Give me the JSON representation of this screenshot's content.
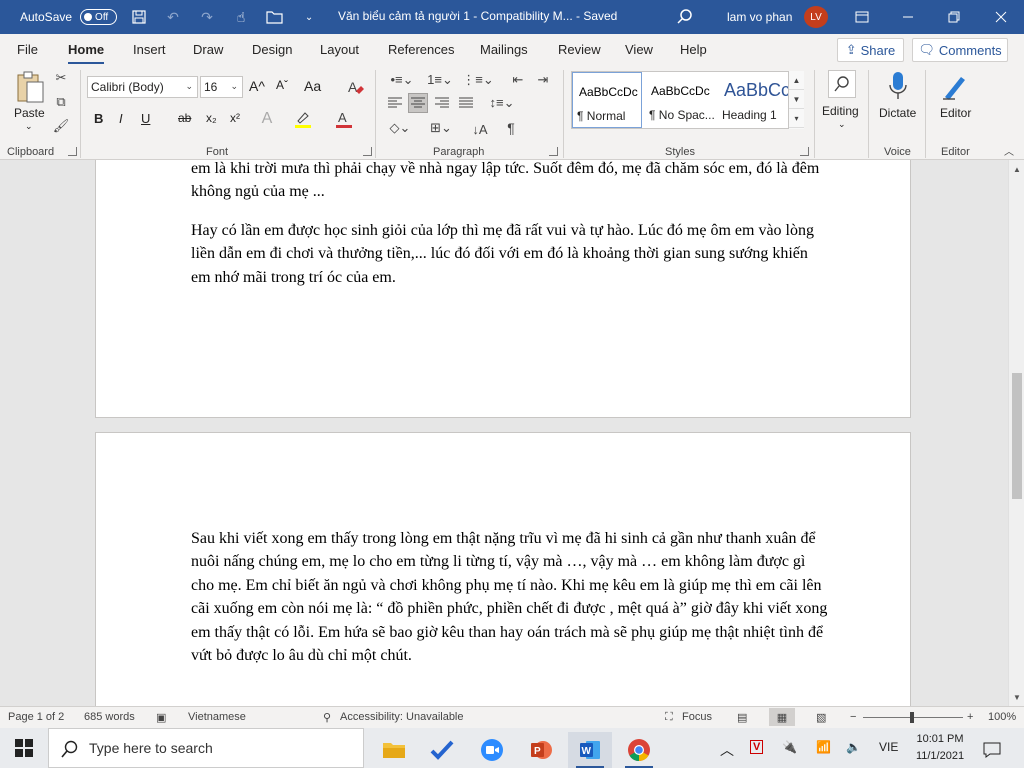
{
  "titlebar": {
    "autosave_label": "AutoSave",
    "autosave_state": "Off",
    "doc_title": "Văn biểu cảm tả người 1  -  Compatibility M...  -  Saved",
    "user_name": "lam vo phan",
    "user_initials": "LV"
  },
  "tabs": [
    "File",
    "Home",
    "Insert",
    "Draw",
    "Design",
    "Layout",
    "References",
    "Mailings",
    "Review",
    "View",
    "Help"
  ],
  "share_label": "Share",
  "comments_label": "Comments",
  "ribbon": {
    "clipboard": {
      "paste": "Paste",
      "label": "Clipboard"
    },
    "font": {
      "name": "Calibri (Body)",
      "size": "16",
      "label": "Font",
      "bold": "B",
      "italic": "I",
      "underline": "U",
      "strike": "ab",
      "sub": "x₂",
      "sup": "x²",
      "grow": "A^",
      "shrink": "Aˇ",
      "case": "Aa"
    },
    "paragraph": {
      "label": "Paragraph"
    },
    "styles": {
      "label": "Styles",
      "items": [
        {
          "preview": "AaBbCcDc",
          "name": "¶ Normal"
        },
        {
          "preview": "AaBbCcDc",
          "name": "¶ No Spac..."
        },
        {
          "preview": "AaBbCc",
          "name": "Heading 1"
        }
      ]
    },
    "editing": {
      "label": "Editing"
    },
    "voice": {
      "dictate": "Dictate",
      "label": "Voice"
    },
    "editor": {
      "editor": "Editor",
      "label": "Editor"
    }
  },
  "document": {
    "p1_tail": "em là khi trời mưa thì phải chạy về nhà ngay lập tức. Suốt đêm đó, mẹ đã chăm sóc em, đó là đêm không ngủ của mẹ ...",
    "p2": "Hay có lần em được học sinh giỏi của lớp thì mẹ đã rất vui và tự hào. Lúc đó mẹ ôm em vào lòng liền dẫn em đi chơi và thưởng tiền,... lúc đó đối với em đó là khoảng thời gian sung sướng khiến em nhớ mãi trong trí óc của em.",
    "p3": "Sau khi viết xong em thấy trong lòng em thật nặng trĩu vì mẹ đã hi sinh cả gần như thanh xuân để nuôi nấng chúng em, mẹ lo cho em từng li từng tí, vậy mà …, vậy mà … em không làm được gì cho mẹ. Em chỉ biết ăn ngủ và chơi không phụ mẹ tí nào. Khi mẹ kêu em là giúp mẹ thì em cãi lên cãi xuống em còn nói mẹ là: “ đồ phiền phức, phiền chết đi được , mệt quá à” giờ đây khi viết xong em thấy thật có lỗi. Em hứa sẽ bao giờ kêu than  hay oán trách mà sẽ phụ giúp mẹ thật nhiệt tình để vứt bỏ được lo âu dù chỉ một chút."
  },
  "status": {
    "page": "Page 1 of 2",
    "words": "685 words",
    "language": "Vietnamese",
    "accessibility": "Accessibility: Unavailable",
    "focus": "Focus",
    "zoom": "100%",
    "zoom_minus": "−",
    "zoom_plus": "+"
  },
  "taskbar": {
    "search_placeholder": "Type here to search",
    "lang": "VIE",
    "time": "10:01 PM",
    "date": "11/1/2021"
  }
}
